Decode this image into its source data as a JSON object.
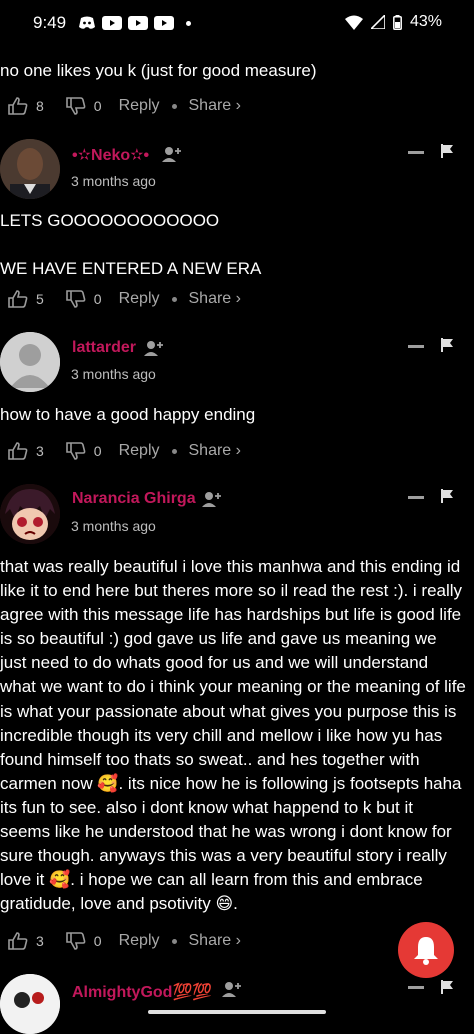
{
  "status": {
    "time": "9:49",
    "battery": "43%"
  },
  "comments": [
    {
      "text": "no one likes you k (just for good measure)",
      "likes": "8",
      "dislikes": "0"
    },
    {
      "user": "•✫Neko✫•",
      "time": "3 months ago",
      "text": "LETS GOOOOOOOOOOOO\n\nWE HAVE ENTERED A NEW ERA",
      "likes": "5",
      "dislikes": "0"
    },
    {
      "user": "lattarder",
      "time": "3 months ago",
      "text": "how to have a good happy ending",
      "likes": "3",
      "dislikes": "0"
    },
    {
      "user": "Narancia Ghirga",
      "time": "3 months ago",
      "text": "that was really beautiful i love this manhwa and this ending id like it to end here but theres more so il read the rest :). i really agree with this message life has hardships but life is good life is so beautiful :) god gave us life and gave us meaning we just need to do whats good for us and we will understand what we want to do i think your meaning or the meaning of life is what your passionate about what gives you purpose this is incredible though its very chill and mellow i like how yu has found himself too thats so sweat.. and hes together with carmen now 🥰. its nice how he is following js footsepts haha its fun to see. also i dont know what happend to k but it seems like he understood that he was wrong i dont know for sure though. anyways this was a very beautiful story i really love it 🥰. i hope we can all learn from this and embrace gratidude, love and psotivity 😄.",
      "likes": "3",
      "dislikes": "0"
    },
    {
      "user": "AlmightyGod💯💯"
    }
  ],
  "labels": {
    "reply": "Reply",
    "share": "Share ›"
  }
}
